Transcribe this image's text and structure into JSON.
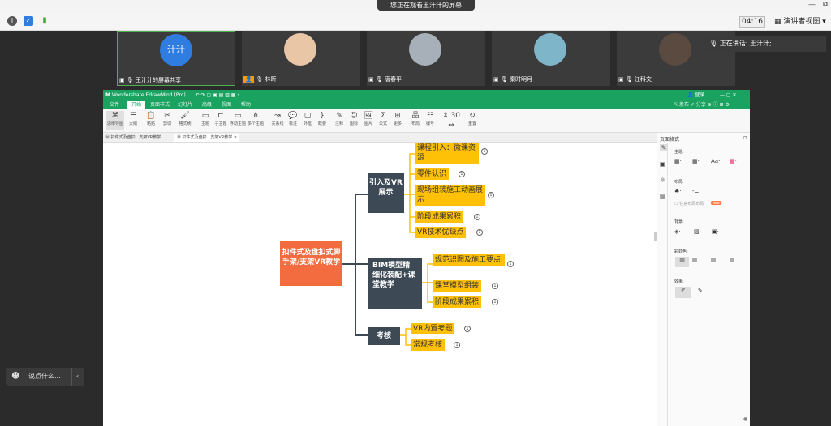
{
  "banner": "您正在观看王汁汁的屏幕",
  "window_controls": {
    "minimize": "—",
    "restore": "⧉"
  },
  "timer": "04:16",
  "presenter_view": "演讲者视图",
  "participants": [
    {
      "name": "王汁汁的屏幕共享",
      "avatar_text": "汁汁"
    },
    {
      "name": "林昕"
    },
    {
      "name": "唐春平"
    },
    {
      "name": "秦时明月"
    },
    {
      "name": "江科文"
    }
  ],
  "speaking": "正在讲话: 王汁汁;",
  "chat_placeholder": "说点什么...",
  "app": {
    "title": "Wondershare EdrawMind (Pro)",
    "login": "登录",
    "menu": [
      "文件",
      "开始",
      "页面样式",
      "幻灯片",
      "高级",
      "视图",
      "帮助"
    ],
    "ribbon": [
      "思维导图",
      "大纲",
      "粘贴",
      "剪切",
      "格式刷",
      "主题",
      "子主题",
      "浮动主题",
      "多个主题",
      "关系线",
      "标注",
      "外框",
      "概要",
      "注释",
      "图标",
      "图片",
      "公式",
      "更多",
      "布局",
      "编号",
      "重置"
    ],
    "doc_tabs": [
      "扣件式及盘扣...支架VR教学",
      "扣件式及盘扣...支架VR教学"
    ],
    "sidebar": {
      "title": "页面格式",
      "theme": "主题:",
      "layout": "布局:",
      "background": "背景:",
      "rainbow": "彩虹色:",
      "effects": "效果:",
      "font_label": "Aa",
      "new_badge": "New",
      "checkbox_label": "任意布局布局"
    }
  },
  "mindmap": {
    "root": "扣件式及盘扣式脚手架/支架VR教学",
    "branches": [
      {
        "label": "引入及VR展示",
        "leaves": [
          "课程引入：微课资源",
          "零件认识",
          "现场组装施工动画展示",
          "阶段成果累积",
          "VR技术优缺点"
        ]
      },
      {
        "label": "BIM模型精细化装配+课堂教学",
        "leaves": [
          "规范识图及施工要点",
          "课堂模型组装",
          "阶段成果累积"
        ]
      },
      {
        "label": "考核",
        "leaves": [
          "VR内置考题",
          "常规考核"
        ]
      }
    ]
  }
}
